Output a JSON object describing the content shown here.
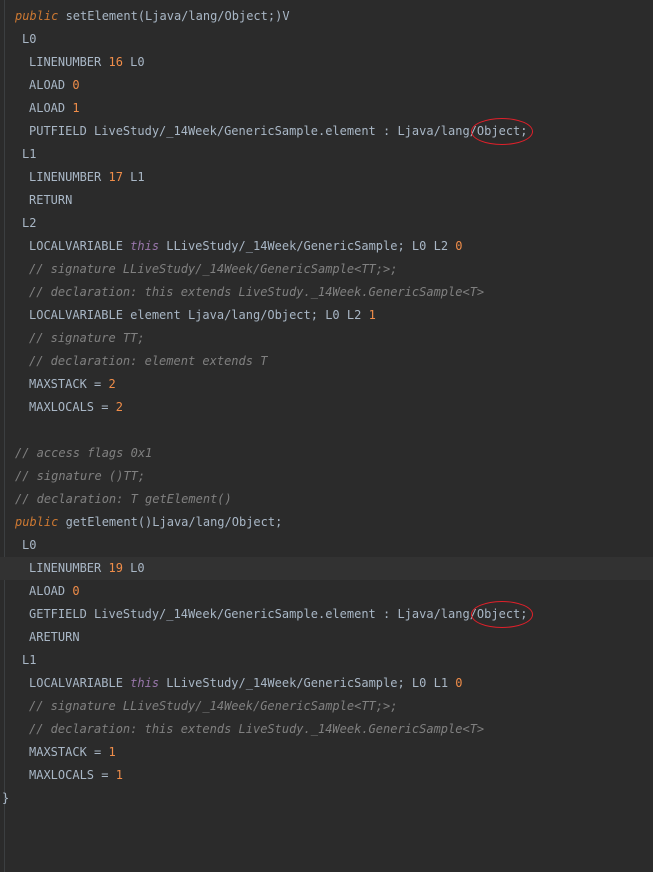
{
  "code_lines": [
    {
      "indent": 1,
      "tokens": [
        {
          "t": "kw",
          "v": "public"
        },
        {
          "t": "plain",
          "v": " setElement(Ljava/lang/Object;)V"
        }
      ]
    },
    {
      "indent": 2,
      "tokens": [
        {
          "t": "plain",
          "v": "L0"
        }
      ]
    },
    {
      "indent": 3,
      "tokens": [
        {
          "t": "plain",
          "v": "LINENUMBER "
        },
        {
          "t": "num",
          "v": "16"
        },
        {
          "t": "plain",
          "v": " L0"
        }
      ]
    },
    {
      "indent": 3,
      "tokens": [
        {
          "t": "plain",
          "v": "ALOAD "
        },
        {
          "t": "num",
          "v": "0"
        }
      ]
    },
    {
      "indent": 3,
      "tokens": [
        {
          "t": "plain",
          "v": "ALOAD "
        },
        {
          "t": "num",
          "v": "1"
        }
      ]
    },
    {
      "indent": 3,
      "tokens": [
        {
          "t": "plain",
          "v": "PUTFIELD LiveStudy/_14Week/GenericSample.element : Ljava/lang/Object;"
        }
      ],
      "marked": true
    },
    {
      "indent": 2,
      "tokens": [
        {
          "t": "plain",
          "v": "L1"
        }
      ]
    },
    {
      "indent": 3,
      "tokens": [
        {
          "t": "plain",
          "v": "LINENUMBER "
        },
        {
          "t": "num",
          "v": "17"
        },
        {
          "t": "plain",
          "v": " L1"
        }
      ]
    },
    {
      "indent": 3,
      "tokens": [
        {
          "t": "plain",
          "v": "RETURN"
        }
      ]
    },
    {
      "indent": 2,
      "tokens": [
        {
          "t": "plain",
          "v": "L2"
        }
      ]
    },
    {
      "indent": 3,
      "tokens": [
        {
          "t": "plain",
          "v": "LOCALVARIABLE "
        },
        {
          "t": "this",
          "v": "this"
        },
        {
          "t": "plain",
          "v": " LLiveStudy/_14Week/GenericSample; L0 L2 "
        },
        {
          "t": "num",
          "v": "0"
        }
      ]
    },
    {
      "indent": 3,
      "tokens": [
        {
          "t": "cmt",
          "v": "// signature LLiveStudy/_14Week/GenericSample<TT;>;"
        }
      ]
    },
    {
      "indent": 3,
      "tokens": [
        {
          "t": "cmt",
          "v": "// declaration: this extends LiveStudy._14Week.GenericSample<T>"
        }
      ]
    },
    {
      "indent": 3,
      "tokens": [
        {
          "t": "plain",
          "v": "LOCALVARIABLE element Ljava/lang/Object; L0 L2 "
        },
        {
          "t": "num",
          "v": "1"
        }
      ]
    },
    {
      "indent": 3,
      "tokens": [
        {
          "t": "cmt",
          "v": "// signature TT;"
        }
      ]
    },
    {
      "indent": 3,
      "tokens": [
        {
          "t": "cmt",
          "v": "// declaration: element extends T"
        }
      ]
    },
    {
      "indent": 3,
      "tokens": [
        {
          "t": "plain",
          "v": "MAXSTACK = "
        },
        {
          "t": "num",
          "v": "2"
        }
      ]
    },
    {
      "indent": 3,
      "tokens": [
        {
          "t": "plain",
          "v": "MAXLOCALS = "
        },
        {
          "t": "num",
          "v": "2"
        }
      ]
    },
    {
      "indent": 0,
      "tokens": []
    },
    {
      "indent": 1,
      "tokens": [
        {
          "t": "cmt",
          "v": "// access flags 0x1"
        }
      ]
    },
    {
      "indent": 1,
      "tokens": [
        {
          "t": "cmt",
          "v": "// signature ()TT;"
        }
      ]
    },
    {
      "indent": 1,
      "tokens": [
        {
          "t": "cmt",
          "v": "// declaration: T getElement()"
        }
      ]
    },
    {
      "indent": 1,
      "tokens": [
        {
          "t": "kw",
          "v": "public"
        },
        {
          "t": "plain",
          "v": " getElement()Ljava/lang/Object;"
        }
      ]
    },
    {
      "indent": 2,
      "tokens": [
        {
          "t": "plain",
          "v": "L0"
        }
      ]
    },
    {
      "indent": 3,
      "tokens": [
        {
          "t": "plain",
          "v": "LINENUMBER "
        },
        {
          "t": "num",
          "v": "19"
        },
        {
          "t": "plain",
          "v": " L0"
        }
      ],
      "current": true
    },
    {
      "indent": 3,
      "tokens": [
        {
          "t": "plain",
          "v": "ALOAD "
        },
        {
          "t": "num",
          "v": "0"
        }
      ]
    },
    {
      "indent": 3,
      "tokens": [
        {
          "t": "plain",
          "v": "GETFIELD LiveStudy/_14Week/GenericSample.element : Ljava/lang/Object;"
        }
      ],
      "marked": true
    },
    {
      "indent": 3,
      "tokens": [
        {
          "t": "plain",
          "v": "ARETURN"
        }
      ]
    },
    {
      "indent": 2,
      "tokens": [
        {
          "t": "plain",
          "v": "L1"
        }
      ]
    },
    {
      "indent": 3,
      "tokens": [
        {
          "t": "plain",
          "v": "LOCALVARIABLE "
        },
        {
          "t": "this",
          "v": "this"
        },
        {
          "t": "plain",
          "v": " LLiveStudy/_14Week/GenericSample; L0 L1 "
        },
        {
          "t": "num",
          "v": "0"
        }
      ]
    },
    {
      "indent": 3,
      "tokens": [
        {
          "t": "cmt",
          "v": "// signature LLiveStudy/_14Week/GenericSample<TT;>;"
        }
      ]
    },
    {
      "indent": 3,
      "tokens": [
        {
          "t": "cmt",
          "v": "// declaration: this extends LiveStudy._14Week.GenericSample<T>"
        }
      ]
    },
    {
      "indent": 3,
      "tokens": [
        {
          "t": "plain",
          "v": "MAXSTACK = "
        },
        {
          "t": "num",
          "v": "1"
        }
      ]
    },
    {
      "indent": 3,
      "tokens": [
        {
          "t": "plain",
          "v": "MAXLOCALS = "
        },
        {
          "t": "num",
          "v": "1"
        }
      ]
    },
    {
      "indent": 0,
      "tokens": [
        {
          "t": "plain",
          "v": "}"
        }
      ]
    }
  ],
  "colors": {
    "background": "#2b2b2b",
    "text": "#a9b7c6",
    "keyword": "#cc7832",
    "this": "#9876aa",
    "number": "#f08d49",
    "comment": "#808080",
    "annotation_circle": "#e0202a"
  }
}
